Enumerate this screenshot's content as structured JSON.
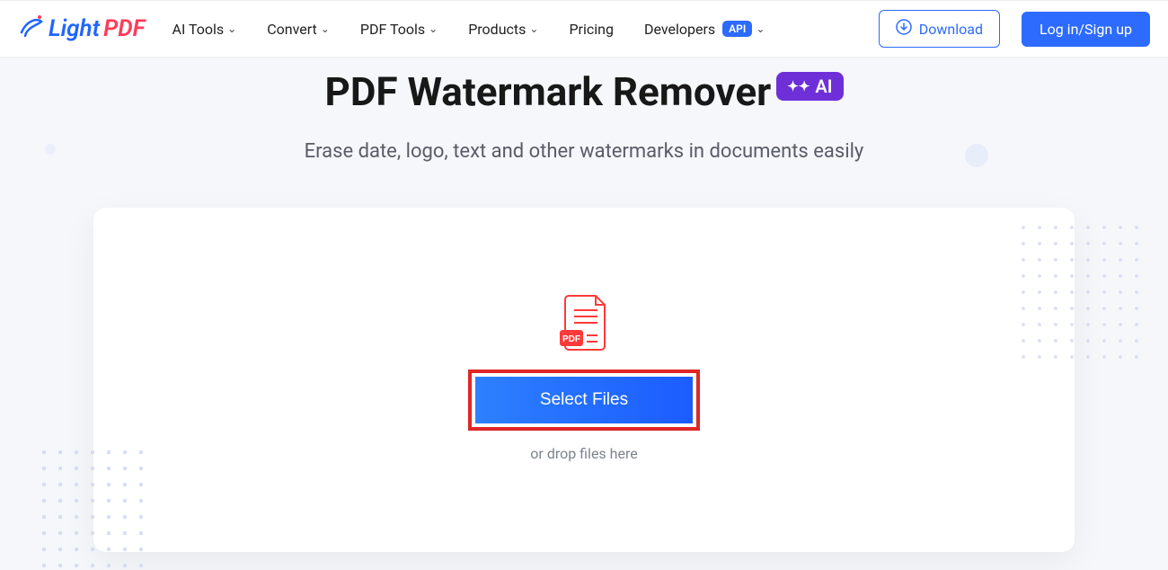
{
  "logo": {
    "light": "Light",
    "pdf": "PDF"
  },
  "nav": {
    "ai_tools": "AI Tools",
    "convert": "Convert",
    "pdf_tools": "PDF Tools",
    "products": "Products",
    "pricing": "Pricing",
    "developers": "Developers",
    "api_badge": "API"
  },
  "buttons": {
    "download": "Download",
    "login": "Log in/Sign up",
    "select_files": "Select Files"
  },
  "hero": {
    "title": "PDF Watermark Remover",
    "ai_badge": "AI",
    "subtitle": "Erase date, logo, text and other watermarks in documents easily",
    "drop_hint": "or drop files here"
  },
  "icons": {
    "pdf_label": "PDF"
  }
}
